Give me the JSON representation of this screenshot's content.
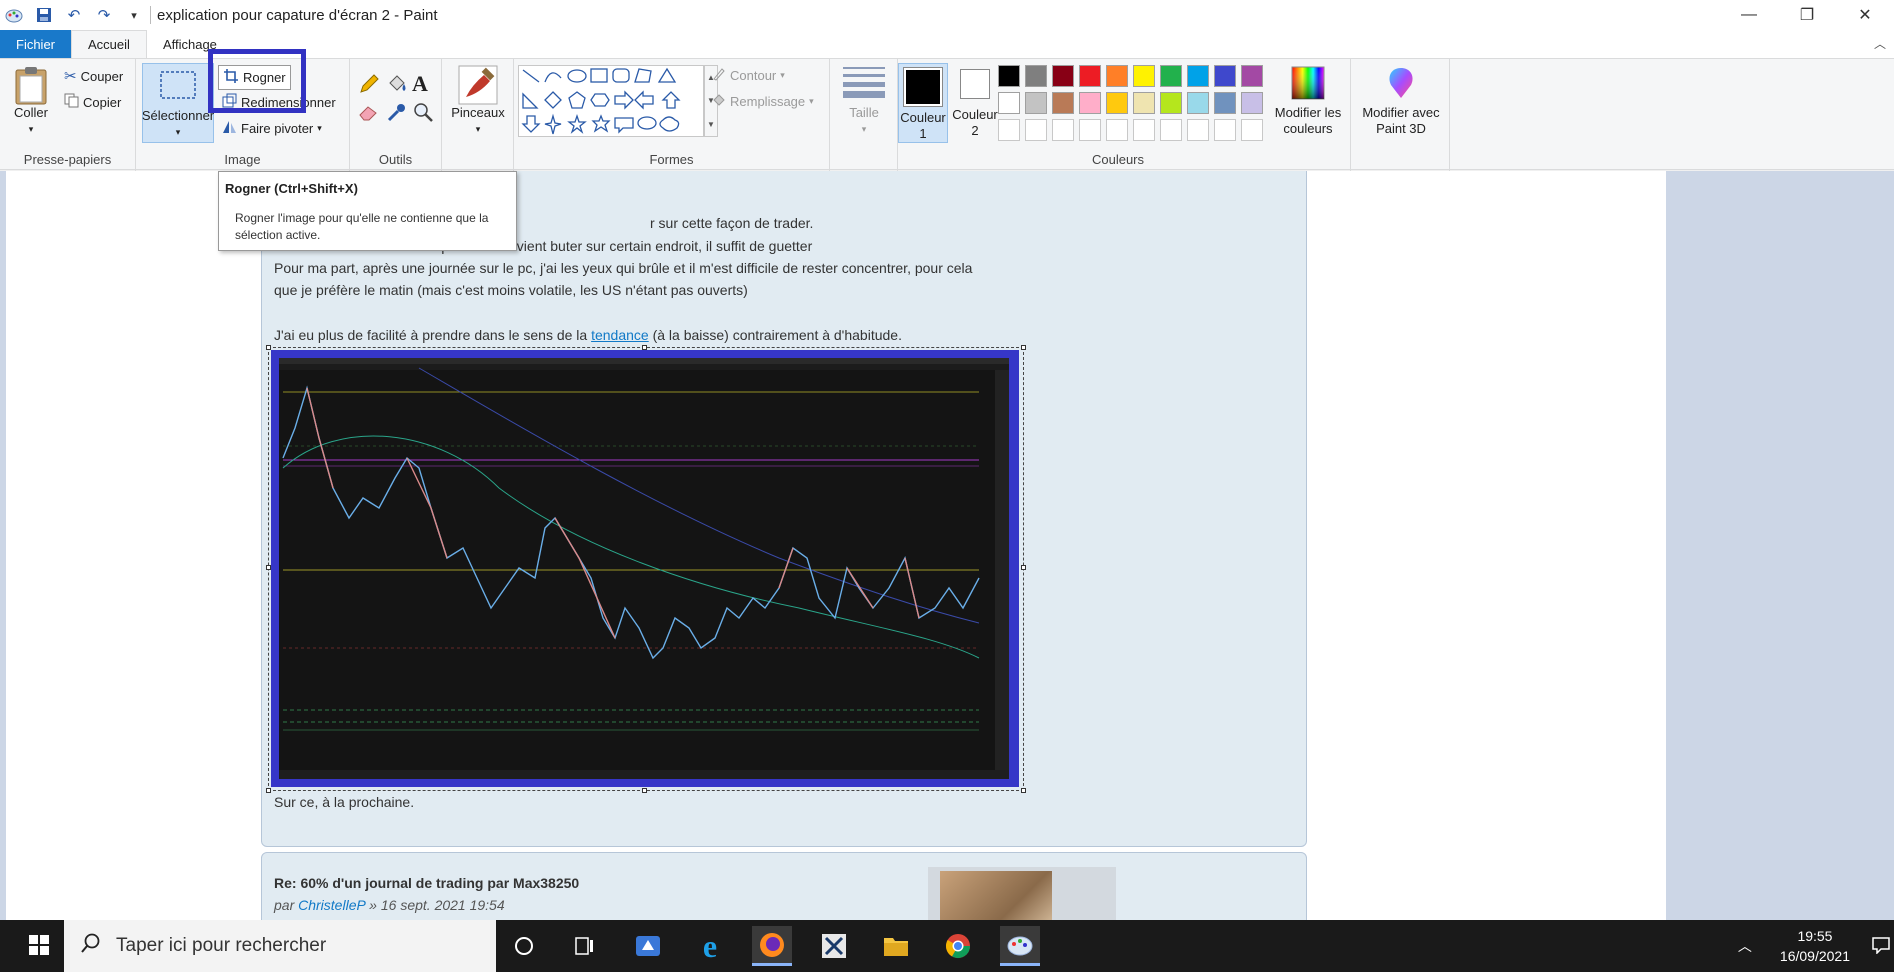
{
  "window": {
    "title": "explication pour capature d'écran 2 - Paint",
    "minimize": "—",
    "maximize": "❐",
    "close": "✕"
  },
  "tabs": {
    "file": "Fichier",
    "home": "Accueil",
    "view": "Affichage"
  },
  "ribbon": {
    "clipboard": {
      "label": "Presse-papiers",
      "paste": "Coller",
      "cut": "Couper",
      "copy": "Copier"
    },
    "image": {
      "label": "Image",
      "select": "Sélectionner",
      "crop": "Rogner",
      "resize": "Redimensionner",
      "rotate": "Faire pivoter"
    },
    "tools": {
      "label": "Outils"
    },
    "brushes": {
      "label": "Pinceaux"
    },
    "shapes": {
      "label": "Formes",
      "outline": "Contour",
      "fill": "Remplissage"
    },
    "size": {
      "label": "Taille"
    },
    "colors": {
      "label": "Couleurs",
      "color1": "Couleur 1",
      "color2": "Couleur 2",
      "edit": "Modifier les couleurs",
      "paint3d": "Modifier avec Paint 3D",
      "palette_row1": [
        "#000000",
        "#7f7f7f",
        "#880015",
        "#ed1c24",
        "#ff7f27",
        "#fff200",
        "#22b14c",
        "#00a2e8",
        "#3f48cc",
        "#a349a4"
      ],
      "palette_row2": [
        "#ffffff",
        "#c3c3c3",
        "#b97a57",
        "#ffaec9",
        "#ffc90e",
        "#efe4b0",
        "#b5e61d",
        "#99d9ea",
        "#7092be",
        "#c8bfe7"
      ]
    }
  },
  "tooltip": {
    "title": "Rogner (Ctrl+Shift+X)",
    "body": "Rogner l'image pour qu'elle ne contienne que la sélection active."
  },
  "post": {
    "line1": "r sur cette façon de trader.",
    "line2": "Même en 100ticks on voit que le cours vient buter sur certain endroit, il suffit de guetter",
    "line3": "Pour ma part, après une journée sur le pc, j'ai les yeux qui brûle et il m'est difficile de rester concentrer, pour cela",
    "line4": "que je préfère le matin (mais c'est moins volatile, les US n'étant pas ouverts)",
    "line5_a": "J'ai eu plus de facilité à prendre dans le sens de la ",
    "line5_link": "tendance",
    "line5_b": " (à la baisse) contrairement à d'habitude.",
    "closing": "Sur ce, à la prochaine."
  },
  "post2": {
    "title": "Re: 60% d'un journal de trading par Max38250",
    "by": "par ",
    "author": "ChristelleP",
    "date": " » 16 sept. 2021 19:54"
  },
  "taskbar": {
    "search_placeholder": "Taper ici pour rechercher",
    "time": "19:55",
    "date": "16/09/2021"
  }
}
